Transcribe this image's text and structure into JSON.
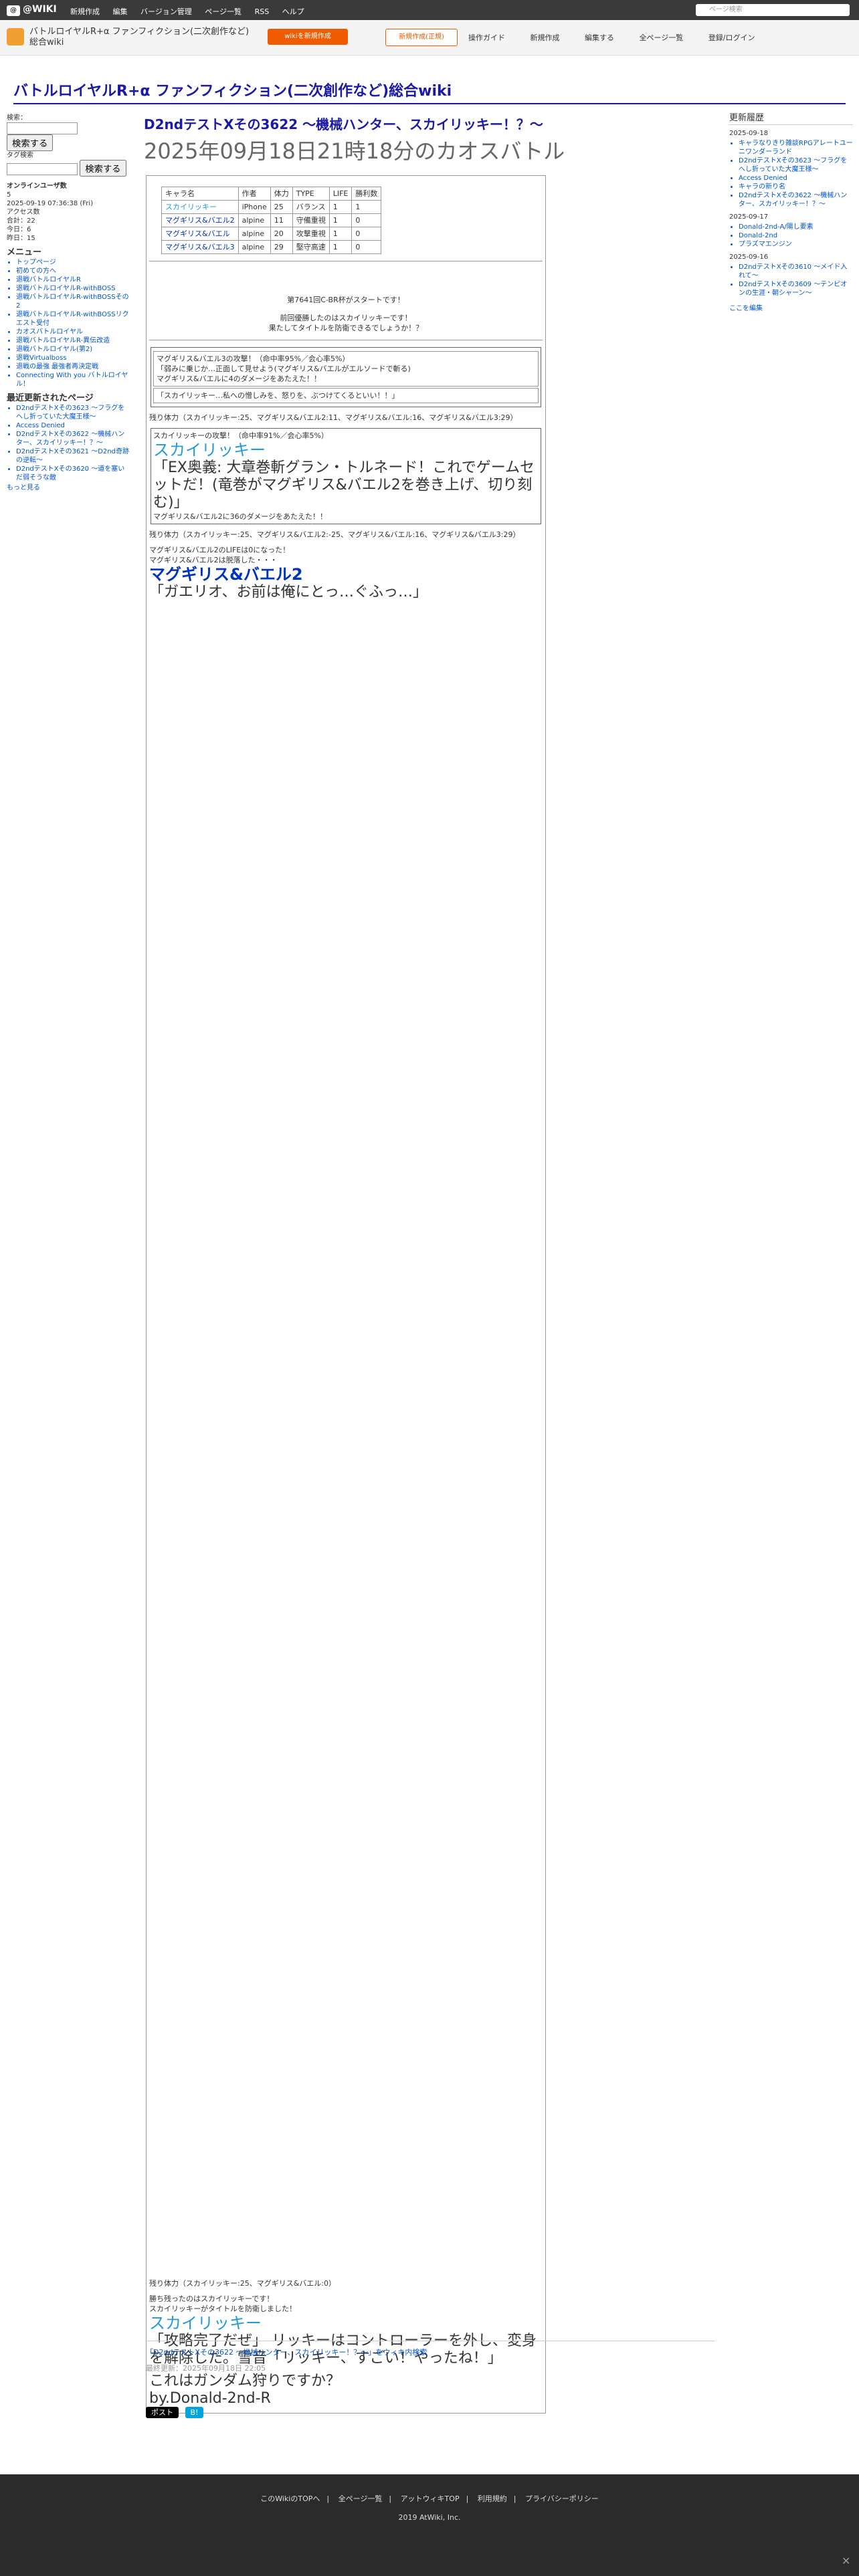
{
  "topbar": {
    "logo": "@WIKI",
    "menu": [
      "新規作成",
      "編集",
      "バージョン管理",
      "ページ一覧",
      "RSS",
      "ヘルプ"
    ],
    "search_placeholder": "ページ検索"
  },
  "subbar": {
    "wiki_name": "バトルロイヤルR+α ファンフィクション(二次創作など)総合wiki",
    "btn_orange": "wikiを新規作成",
    "btn_white": "新規作成(正規)",
    "actions": [
      "操作ガイド",
      "新規作成",
      "編集する",
      "全ページ一覧",
      "登録/ログイン"
    ]
  },
  "site_title": "バトルロイヤルR+α ファンフィクション(二次創作など)総合wiki",
  "page": {
    "title": "D2ndテストXその3622 〜機械ハンター、スカイリッキー！？〜",
    "subtitle": "2025年09月18日21時18分のカオスバトル"
  },
  "left": {
    "search_label": "検索：",
    "search_button": "検索する",
    "tag_label": "タグ検索",
    "online_label": "オンラインユーザ数",
    "online_count": "5",
    "updated": "2025-09-19 07:36:38 (Fri)",
    "access": "アクセス数",
    "total": "合計：22",
    "today": "今日：6",
    "yesterday": "昨日：15",
    "menu_title": "メニュー",
    "menu": [
      "トップページ",
      "初めての方へ",
      "退戦バトルロイヤルR",
      "退戦バトルロイヤルR-withBOSS",
      "退戦バトルロイヤルR-withBOSSその2",
      "退戦バトルロイヤルR-withBOSSリクエスト受付",
      "カオスバトルロイヤル",
      "退戦バトルロイヤルR-異伝改造",
      "退戦バトルロイヤル(第2)",
      "退戦Virtualboss",
      "退戦の最強 最強者再決定戦",
      "Connecting With you バトルロイヤル！"
    ],
    "recent_title": "最近更新されたページ",
    "recent": [
      "D2ndテストXその3623 〜フラグをへし折っていた大魔王様〜",
      "Access Denied",
      "D2ndテストXその3622 〜機械ハンター、スカイリッキー！？〜",
      "D2ndテストXその3621 〜D2nd奇跡の逆転〜",
      "D2ndテストXその3620 〜道を塞いだ弱そうな敵"
    ],
    "more": "もっと見る"
  },
  "right": {
    "title": "更新履歴",
    "groups": [
      {
        "date": "2025-09-18",
        "items": [
          "キャラなりきり雑談RPGアレートユーニワンダーランド",
          "D2ndテストXその3623 〜フラグをへし折っていた大魔王様〜",
          "Access Denied",
          "キャラの新り名",
          "D2ndテストXその3622 〜機械ハンター、スカイリッキー！？〜"
        ]
      },
      {
        "date": "2025-09-17",
        "items": [
          "Donald-2nd-A/陽し要素",
          "Donald-2nd",
          "プラズマエンジン"
        ]
      },
      {
        "date": "2025-09-16",
        "items": [
          "D2ndテストXその3610 〜メイド入れて〜",
          "D2ndテストXその3609 〜テンピオンの生涯・朝シャーン〜"
        ]
      }
    ],
    "footer": "ここを編集"
  },
  "battle": {
    "table": {
      "headers": [
        "キャラ名",
        "作者",
        "体力",
        "TYPE",
        "LIFE",
        "勝利数"
      ],
      "rows": [
        [
          "スカイリッキー",
          "iPhone",
          "25",
          "バランス",
          "1",
          "1"
        ],
        [
          "マグギリス&バエル2",
          "alpine",
          "11",
          "守備重視",
          "1",
          "0"
        ],
        [
          "マグギリス&バエル",
          "alpine",
          "20",
          "攻撃重視",
          "1",
          "0"
        ],
        [
          "マグギリス&バエル3",
          "alpine",
          "29",
          "堅守高速",
          "1",
          "0"
        ]
      ]
    },
    "start": "第7641回C-BR杯がスタートです！",
    "lead1": "前回優勝したのはスカイリッキーです！",
    "lead2": "果たしてタイトルを防衛できるでしょうか！？",
    "r1_attack": "マグギリス&バエル3の攻撃！（命中率95%／会心率5%）",
    "r1_quote": "「弱みに乗じか…正面して見せよう(マグギリス&バエルがエルソードで斬る)",
    "r1_dmg": "マグギリス&バエルに4のダメージをあたえた！！",
    "r1_reply": "「スカイリッキー…私への憎しみを、怒りを、ぶつけてくるといい！！」",
    "remain1": "残り体力（スカイリッキー:25、マグギリス&バエル2:11、マグギリス&バエル:16、マグギリス&バエル3:29）",
    "r2_attack": "スカイリッキーの攻撃！（命中率91%／会心率5%）",
    "r2_big": "スカイリッキー",
    "r2_quote": "「EX奥義: 大章巻斬グラン・トルネード！これでゲームセットだ！(竜巻がマグギリス&バエル2を巻き上げ、切り刻む)」",
    "r2_dmg": "マグギリス&バエル2に36のダメージをあたえた！！",
    "remain2": "残り体力（スカイリッキー:25、マグギリス&バエル2:-25、マグギリス&バエル:16、マグギリス&バエル3:29）",
    "ko1": "マグギリス&バエル2のLIFEは0になった！",
    "ko1b": "マグギリス&バエル2は脱落した・・・",
    "ko1_big": "マグギリス&バエル2",
    "ko1_quote": "「ガエリオ、お前は俺にとっ…ぐふっ…」",
    "remain_final": "残り体力（スカイリッキー:25、マグギリス&バエル:0）",
    "win1": "勝ち残ったのはスカイリッキーです！",
    "win2": "スカイリッキーがタイトルを防衛しました！",
    "win_big": "スカイリッキー",
    "win_quote": "「攻略完了だぜ」 リッキーはコントローラーを外し、変身を解除した。雪音「リッキー、すごい！やったね！」",
    "end1": "これはガンダム狩りですか？",
    "end2": "by.Donald-2nd-R"
  },
  "bottom": {
    "edit_link": "「D2ndテストXその3622 〜機械ハンター、スカイリッキー！？〜」をウィキ内検索",
    "updated": "最終更新：2025年09月18日 22:05",
    "tweet": "ポスト",
    "share": "B!"
  },
  "footer": {
    "links": [
      "このWikiのTOPへ",
      "全ページ一覧",
      "アットウィキTOP",
      "利用規約",
      "プライバシーポリシー"
    ],
    "copy": "2019 AtWiki, Inc."
  }
}
